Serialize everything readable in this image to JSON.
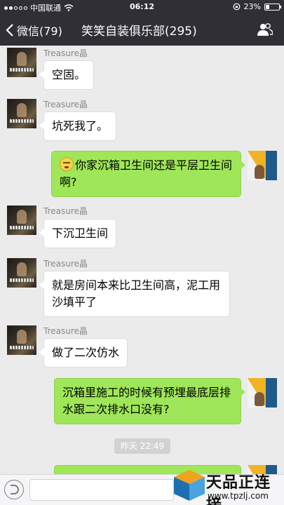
{
  "status_bar": {
    "carrier": "中国联通",
    "time": "06:12",
    "battery": "23%"
  },
  "nav": {
    "back_label": "微信(79)",
    "title": "笑笑自装俱乐部(295)"
  },
  "messages": [
    {
      "sender": "Treasure晶",
      "side": "left",
      "text": "空固。"
    },
    {
      "sender": "Treasure晶",
      "side": "left",
      "text": "坑死我了。"
    },
    {
      "side": "right",
      "emoji": "awkward-face",
      "text": "你家沉箱卫生间还是平层卫生间啊?"
    },
    {
      "sender": "Treasure晶",
      "side": "left",
      "text": "下沉卫生间"
    },
    {
      "sender": "Treasure晶",
      "side": "left",
      "text": "就是房间本来比卫生间高，泥工用沙填平了"
    },
    {
      "sender": "Treasure晶",
      "side": "left",
      "text": "做了二次仿水"
    },
    {
      "side": "right",
      "text": "沉箱里施工的时候有预埋最底层排水跟二次排水口没有?"
    }
  ],
  "timestamp": "昨天 22:49",
  "watermark": {
    "name": "天品正连接",
    "url": "www.tpzlj.com"
  },
  "colors": {
    "top_bar": "#2f2f35",
    "background": "#ebebeb",
    "my_bubble": "#9fe658",
    "their_bubble": "#ffffff"
  }
}
